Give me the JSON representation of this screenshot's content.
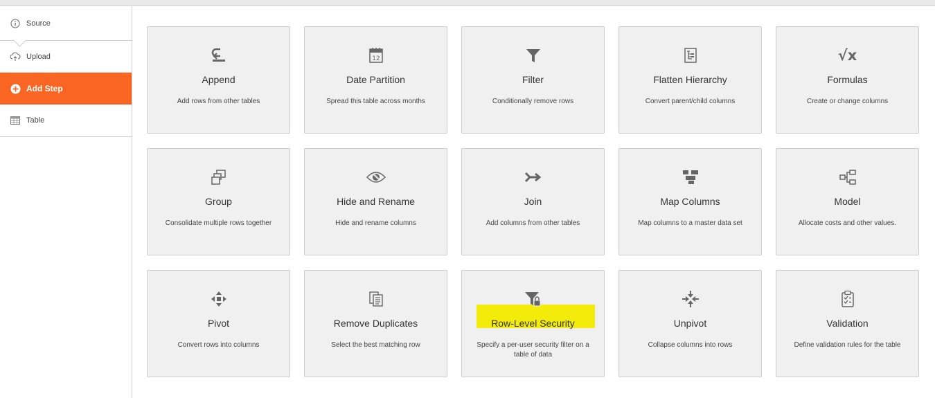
{
  "sidebar": {
    "items": [
      {
        "key": "source",
        "label": "Source",
        "icon": "info-icon"
      },
      {
        "key": "upload",
        "label": "Upload",
        "icon": "cloud-upload-icon"
      },
      {
        "key": "add_step",
        "label": "Add Step",
        "icon": "plus-circle-icon",
        "active": true
      },
      {
        "key": "table",
        "label": "Table",
        "icon": "table-icon"
      }
    ]
  },
  "tiles": [
    {
      "title": "Append",
      "desc": "Add rows from other tables",
      "icon": "append-icon"
    },
    {
      "title": "Date Partition",
      "desc": "Spread this table across months",
      "icon": "calendar-icon",
      "calendar_day": "12"
    },
    {
      "title": "Filter",
      "desc": "Conditionally remove rows",
      "icon": "funnel-icon"
    },
    {
      "title": "Flatten Hierarchy",
      "desc": "Convert parent/child columns",
      "icon": "hierarchy-doc-icon"
    },
    {
      "title": "Formulas",
      "desc": "Create or change columns",
      "icon": "square-root-icon",
      "symbol": "√x"
    },
    {
      "title": "Group",
      "desc": "Consolidate multiple rows together",
      "icon": "group-squares-icon"
    },
    {
      "title": "Hide and Rename",
      "desc": "Hide and rename columns",
      "icon": "eye-icon"
    },
    {
      "title": "Join",
      "desc": "Add columns from other tables",
      "icon": "join-arrow-icon"
    },
    {
      "title": "Map Columns",
      "desc": "Map columns to a master data set",
      "icon": "map-columns-icon"
    },
    {
      "title": "Model",
      "desc": "Allocate costs and other values.",
      "icon": "model-tree-icon"
    },
    {
      "title": "Pivot",
      "desc": "Convert rows into columns",
      "icon": "pivot-arrows-icon"
    },
    {
      "title": "Remove Duplicates",
      "desc": "Select the best matching row",
      "icon": "duplicate-docs-icon"
    },
    {
      "title": "Row-Level Security",
      "desc": "Specify a per-user security filter on a table of data",
      "icon": "funnel-lock-icon",
      "highlighted": true
    },
    {
      "title": "Unpivot",
      "desc": "Collapse columns into rows",
      "icon": "collapse-arrows-icon"
    },
    {
      "title": "Validation",
      "desc": "Define validation rules for the table",
      "icon": "clipboard-check-icon"
    }
  ],
  "colors": {
    "accent": "#f96522",
    "highlight": "#f3ec0b",
    "tile_bg": "#f0f0f0",
    "icon": "#666666"
  }
}
